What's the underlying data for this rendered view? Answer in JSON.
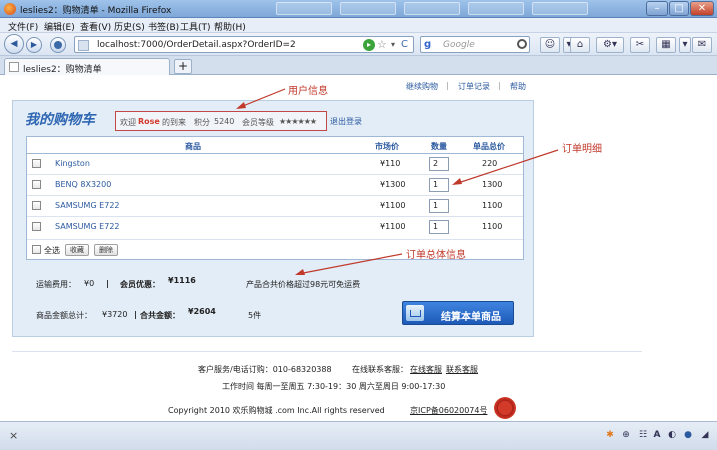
{
  "window": {
    "title": "leslies2：购物清单 - Mozilla Firefox",
    "controls": {
      "minimize": "–",
      "maximize": "□",
      "close": "✕"
    }
  },
  "menu": [
    "文件(F)",
    "编辑(E)",
    "查看(V)",
    "历史(S)",
    "书签(B)",
    "工具(T)",
    "帮助(H)"
  ],
  "nav": {
    "back": "◀",
    "forward": "▶",
    "url": "localhost:7000/OrderDetail.aspx?OrderID=2",
    "go": "▸",
    "star": "☆",
    "dropdown": "▾",
    "reload": "C",
    "search_engine": "g",
    "search_placeholder": "Google",
    "toolbar_icons": [
      "person-icon",
      "dropdown-icon",
      "home-icon",
      "tools-icon",
      "scissors-icon",
      "grid-icon",
      "menu-icon",
      "mail-icon"
    ]
  },
  "tabs": [
    {
      "label": "leslies2：购物清单"
    }
  ],
  "newtab": "+",
  "toplinks": {
    "continue": "继续购物",
    "records": "订单记录",
    "help": "帮助",
    "sep": "|"
  },
  "cart": {
    "title": "我的购物车",
    "user": {
      "welcome_pre": "欢迎",
      "name": "Rose",
      "welcome_post": "的到来",
      "points_label": "积分",
      "points": "5240",
      "level_label": "会员等级",
      "stars": "★★★★★★",
      "star_level": 6,
      "logout": "退出登录"
    },
    "headers": {
      "product": "商品",
      "market": "市场价",
      "qty": "数量",
      "total": "单品总价"
    },
    "items": [
      {
        "name": "Kingston",
        "price": "¥110",
        "qty": "2",
        "total": "220"
      },
      {
        "name": "BENQ 8X3200",
        "price": "¥1300",
        "qty": "1",
        "total": "1300"
      },
      {
        "name": "SAMSUMG E722",
        "price": "¥1100",
        "qty": "1",
        "total": "1100"
      },
      {
        "name": "SAMSUMG E722",
        "price": "¥1100",
        "qty": "1",
        "total": "1100"
      }
    ],
    "select_all": "全选",
    "collect": "收藏",
    "delete": "删除"
  },
  "summary": {
    "shipping_label": "运输费用：",
    "shipping": "¥0",
    "bar": "|",
    "discount_label": "会员优惠：",
    "discount": "¥1116",
    "note": "产品合共价格超过98元可免运费",
    "amount_label": "商品金额总计：",
    "amount": "¥3720",
    "bar2": "|",
    "total_label": "合共金额：",
    "total": "¥2604",
    "count": "5件",
    "checkout": "结算本单商品"
  },
  "annotations": {
    "user": "用户信息",
    "detail": "订单明细",
    "total": "订单总体信息"
  },
  "footer": {
    "service": "客户服务/电话订购：010-68320388",
    "online_label": "在线联系客服：",
    "online_link": "在线客服",
    "contact_link": "联系客服",
    "hours": "工作时间 每周一至周五  7:30-19：30  周六至周日 9:00-17:30",
    "copyright": "Copyright 2010 欢乐购物城 .com Inc.All rights reserved",
    "icp": "京ICP备06020074号"
  },
  "status": {
    "close": "×",
    "icons": [
      "firebug-icon",
      "zoom-icon",
      "text-icon",
      "font-icon",
      "addon-icon",
      "globe-icon",
      "resize-icon"
    ]
  },
  "colors": {
    "accent": "#2e66b2",
    "price": "#e35e14",
    "annotation": "#c0392b"
  }
}
